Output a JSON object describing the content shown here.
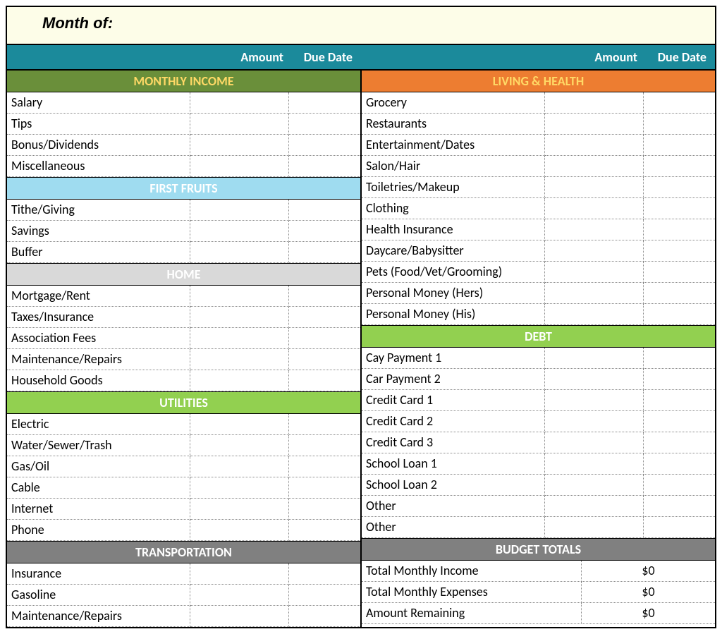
{
  "month_label": "Month of:",
  "col_headers": {
    "amount": "Amount",
    "due": "Due Date"
  },
  "left": [
    {
      "type": "header",
      "style": "h-olive first",
      "title": "MONTHLY INCOME"
    },
    {
      "type": "row",
      "label": "Salary"
    },
    {
      "type": "row",
      "label": "Tips"
    },
    {
      "type": "row",
      "label": "Bonus/Dividends"
    },
    {
      "type": "row",
      "label": "Miscellaneous"
    },
    {
      "type": "header",
      "style": "h-skyblue",
      "title": "FIRST FRUITS"
    },
    {
      "type": "row",
      "label": "Tithe/Giving"
    },
    {
      "type": "row",
      "label": "Savings"
    },
    {
      "type": "row",
      "label": "Buffer"
    },
    {
      "type": "header",
      "style": "h-ltgray",
      "title": "HOME"
    },
    {
      "type": "row",
      "label": "Mortgage/Rent"
    },
    {
      "type": "row",
      "label": "Taxes/Insurance"
    },
    {
      "type": "row",
      "label": "Association Fees"
    },
    {
      "type": "row",
      "label": "Maintenance/Repairs"
    },
    {
      "type": "row",
      "label": "Household Goods"
    },
    {
      "type": "header",
      "style": "h-lime",
      "title": "UTILITIES"
    },
    {
      "type": "row",
      "label": "Electric"
    },
    {
      "type": "row",
      "label": "Water/Sewer/Trash"
    },
    {
      "type": "row",
      "label": "Gas/Oil"
    },
    {
      "type": "row",
      "label": "Cable"
    },
    {
      "type": "row",
      "label": "Internet"
    },
    {
      "type": "row",
      "label": "Phone"
    },
    {
      "type": "header",
      "style": "h-gray",
      "title": "TRANSPORTATION"
    },
    {
      "type": "row",
      "label": "Insurance"
    },
    {
      "type": "row",
      "label": "Gasoline"
    },
    {
      "type": "row",
      "label": "Maintenance/Repairs"
    }
  ],
  "right": [
    {
      "type": "header",
      "style": "h-orange first",
      "title": "LIVING & HEALTH"
    },
    {
      "type": "row",
      "label": "Grocery"
    },
    {
      "type": "row",
      "label": "Restaurants"
    },
    {
      "type": "row",
      "label": "Entertainment/Dates"
    },
    {
      "type": "row",
      "label": "Salon/Hair"
    },
    {
      "type": "row",
      "label": "Toiletries/Makeup"
    },
    {
      "type": "row",
      "label": "Clothing"
    },
    {
      "type": "row",
      "label": "Health Insurance"
    },
    {
      "type": "row",
      "label": "Daycare/Babysitter"
    },
    {
      "type": "row",
      "label": "Pets (Food/Vet/Grooming)"
    },
    {
      "type": "row",
      "label": "Personal Money (Hers)"
    },
    {
      "type": "row",
      "label": "Personal Money (His)"
    },
    {
      "type": "header",
      "style": "h-lime",
      "title": "DEBT"
    },
    {
      "type": "row",
      "label": "Cay Payment 1"
    },
    {
      "type": "row",
      "label": "Car Payment 2"
    },
    {
      "type": "row",
      "label": "Credit Card 1"
    },
    {
      "type": "row",
      "label": "Credit Card 2"
    },
    {
      "type": "row",
      "label": "Credit Card 3"
    },
    {
      "type": "row",
      "label": "School Loan 1"
    },
    {
      "type": "row",
      "label": "School Loan 2"
    },
    {
      "type": "row",
      "label": "Other"
    },
    {
      "type": "row",
      "label": "Other"
    },
    {
      "type": "header",
      "style": "h-gray",
      "title": "BUDGET TOTALS"
    },
    {
      "type": "total",
      "label": "Total Monthly Income",
      "value": "$0"
    },
    {
      "type": "total",
      "label": "Total Monthly Expenses",
      "value": "$0"
    },
    {
      "type": "total",
      "label": "Amount Remaining",
      "value": "$0"
    }
  ]
}
